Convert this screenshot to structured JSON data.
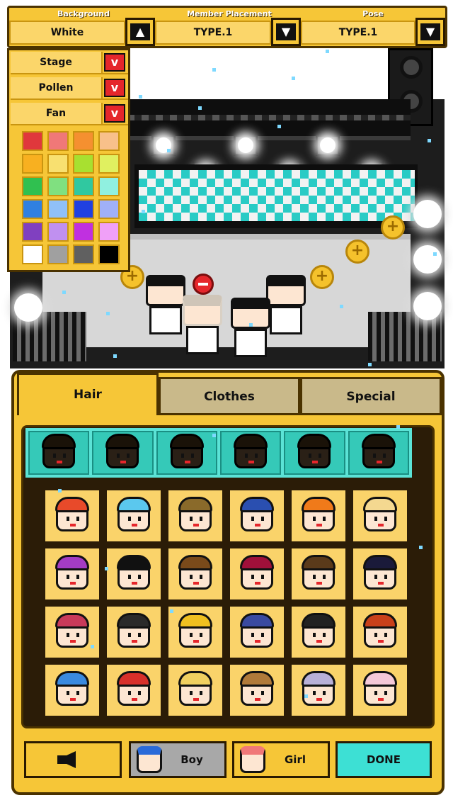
{
  "topbar": {
    "background": {
      "caption": "Background",
      "value": "White",
      "arrow": "up-arrow-icon"
    },
    "placement": {
      "caption": "Member Placement",
      "value": "TYPE.1",
      "arrow": "down-arrow-icon"
    },
    "pose": {
      "caption": "Pose",
      "value": "TYPE.1",
      "arrow": "down-arrow-icon"
    }
  },
  "left_panel": {
    "rows": [
      {
        "label": "Stage"
      },
      {
        "label": "Pollen"
      },
      {
        "label": "Fan"
      }
    ],
    "toggle_glyph": "v",
    "swatches": [
      "#e0383c",
      "#f07878",
      "#f59030",
      "#f8c08a",
      "#f8b020",
      "#f8e070",
      "#a8e030",
      "#e0f060",
      "#30c050",
      "#80e080",
      "#30c8a0",
      "#90f0e0",
      "#3080e0",
      "#90c0f8",
      "#2040e0",
      "#a0b0f8",
      "#8040c0",
      "#c090f0",
      "#c030e0",
      "#f0a0f8",
      "#ffffff",
      "#a0a0a0",
      "#606060",
      "#000000"
    ]
  },
  "tabs": [
    {
      "label": "Hair",
      "active": true
    },
    {
      "label": "Clothes",
      "active": false
    },
    {
      "label": "Special",
      "active": false
    }
  ],
  "hair_dark_row": [
    "hair-style-icon",
    "hair-style-icon",
    "hair-style-icon",
    "hair-style-icon",
    "hair-style-icon",
    "hair-style-icon"
  ],
  "hair_colors": [
    "#e84a2a",
    "#5bc8ee",
    "#8a6a2a",
    "#2a4fb0",
    "#f07a1a",
    "#f4d890",
    "#a43cc4",
    "#111111",
    "#7a4a1a",
    "#a0103a",
    "#5a3a1a",
    "#1a1a3a",
    "#c83a5a",
    "#2a2a2a",
    "#f0c020",
    "#3a4aa0",
    "#222222",
    "#c8401a",
    "#3a8ae0",
    "#d8302a",
    "#f0d060",
    "#b07a3a",
    "#b8b0d8",
    "#f4c8d8"
  ],
  "buttons": {
    "back": "",
    "boy": "Boy",
    "girl": "Girl",
    "done": "DONE"
  },
  "colors": {
    "panel": "#f6c637",
    "accent_red": "#e5262b",
    "done": "#3de0d4",
    "inactive_tab": "#c9b98a"
  }
}
